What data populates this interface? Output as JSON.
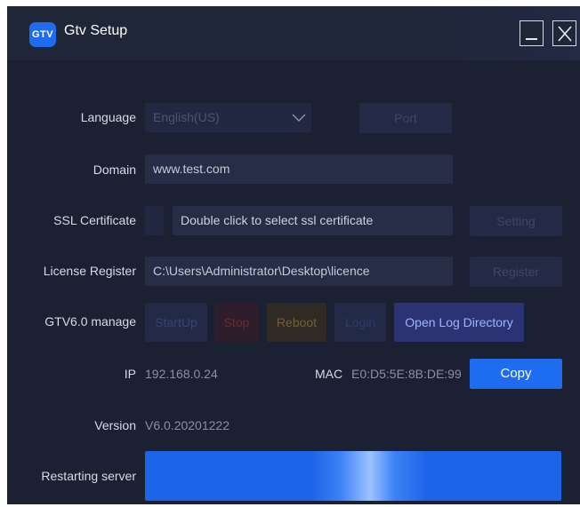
{
  "window": {
    "title": "Gtv Setup",
    "logo_text": "GTV"
  },
  "language": {
    "label": "Language",
    "value": "English(US)",
    "port_label": "Port"
  },
  "domain": {
    "label": "Domain",
    "value": "www.test.com"
  },
  "ssl": {
    "label": "SSL Certificate",
    "placeholder": "Double click to select ssl certificate",
    "setting_label": "Setting"
  },
  "license": {
    "label": "License Register",
    "value": "C:\\Users\\Administrator\\Desktop\\licence",
    "register_label": "Register"
  },
  "manage": {
    "label": "GTV6.0 manage",
    "startup": "StartUp",
    "stop": "Stop",
    "reboot": "Reboot",
    "login": "Login",
    "open_log": "Open Log Directory"
  },
  "network": {
    "ip_label": "IP",
    "ip_value": "192.168.0.24",
    "mac_label": "MAC",
    "mac_value": "E0:D5:5E:8B:DE:99",
    "copy_label": "Copy"
  },
  "version": {
    "label": "Version",
    "value": "V6.0.20201222"
  },
  "status": {
    "label": "Restarting server"
  },
  "icons": {
    "minimize": "minimize-icon",
    "close": "close-icon",
    "dropdown": "chevron-down-icon"
  },
  "colors": {
    "accent": "#1e6cf0",
    "background": "#1b2033",
    "field": "#272d47"
  }
}
